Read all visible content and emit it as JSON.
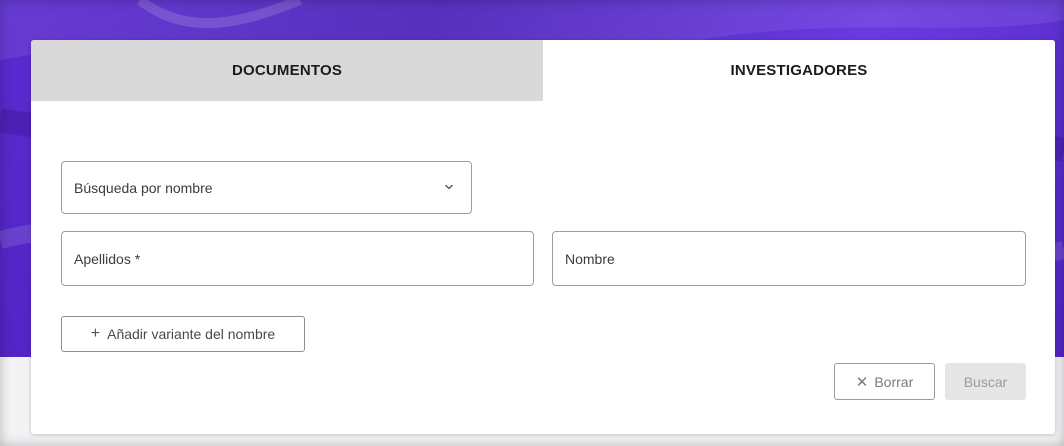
{
  "tabs": [
    {
      "label": "DOCUMENTOS",
      "active": false
    },
    {
      "label": "INVESTIGADORES",
      "active": true
    }
  ],
  "form": {
    "search_by_name_label": "Búsqueda por nombre",
    "surname_label": "Apellidos *",
    "name_label": "Nombre",
    "add_variant_label": "Añadir variante del nombre"
  },
  "actions": {
    "clear_label": "Borrar",
    "search_label": "Buscar"
  },
  "icons": {
    "select_arrow": "chevron-down-icon",
    "add": "plus-icon",
    "clear": "close-icon"
  },
  "colors": {
    "background_accent": "#5b2bd1",
    "inactive_tab": "#d9d9d9",
    "disabled_button": "#e6e6e6"
  }
}
